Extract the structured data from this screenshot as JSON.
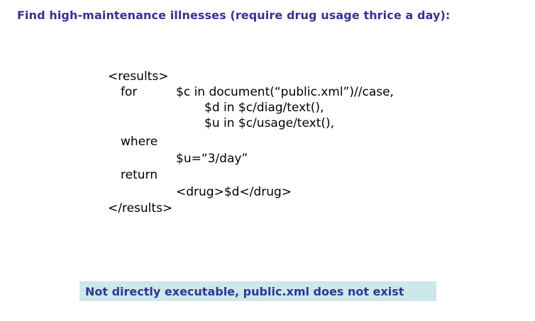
{
  "slide": {
    "title": "Find high-maintenance illnesses (require drug usage thrice a day):",
    "code": {
      "open_tag": "<results>",
      "for_keyword": "for",
      "for_clause_1": "$c in document(“public.xml”)//case,",
      "for_clause_2": "$d in $c/diag/text(),",
      "for_clause_3": "$u in $c/usage/text(),",
      "where_keyword": "where",
      "where_clause": "$u=“3/day”",
      "return_keyword": "return",
      "return_clause": "<drug>$d</drug>",
      "close_tag": "</results>"
    },
    "callout": {
      "text": "Not directly executable, public.xml does not exist",
      "background": "#cce8e8"
    },
    "colors": {
      "title": "#333399",
      "callout_text": "#333399",
      "code_text": "#000000"
    }
  }
}
